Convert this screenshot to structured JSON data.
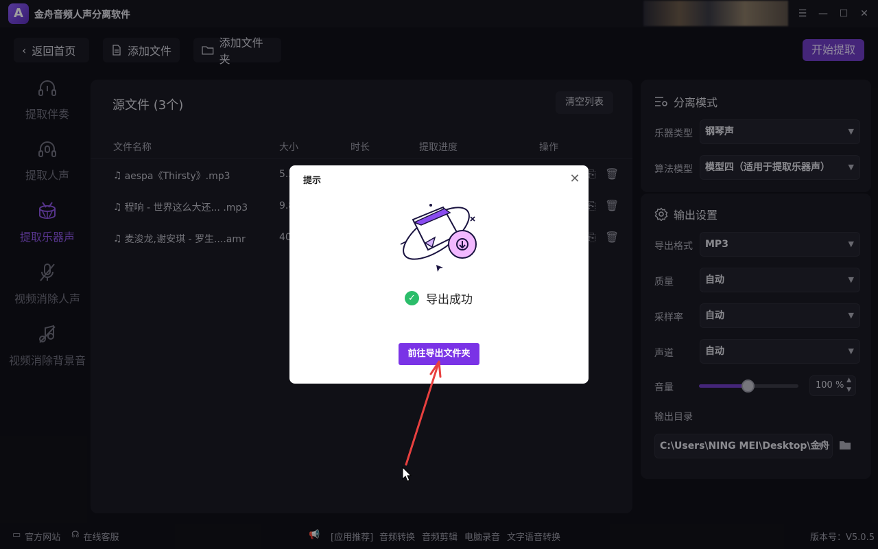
{
  "app": {
    "logo_text": "A",
    "title": "金舟音频人声分离软件"
  },
  "window_controls": {
    "menu": "☰",
    "minimize": "—",
    "maximize": "☐",
    "close": "✕"
  },
  "toolbar": {
    "back": "返回首页",
    "add_file": "添加文件",
    "add_folder": "添加文件夹",
    "start": "开始提取"
  },
  "sidebar": {
    "items": [
      {
        "label": "提取伴奏",
        "icon": "headphones-music-icon",
        "active": false
      },
      {
        "label": "提取人声",
        "icon": "headphones-mic-icon",
        "active": false
      },
      {
        "label": "提取乐器声",
        "icon": "drum-icon",
        "active": true
      },
      {
        "label": "视频消除人声",
        "icon": "mic-off-icon",
        "active": false
      },
      {
        "label": "视频消除背景音",
        "icon": "music-off-icon",
        "active": false
      }
    ]
  },
  "file_panel": {
    "title": "源文件 (3个)",
    "clear": "清空列表",
    "columns": [
      "文件名称",
      "大小",
      "时长",
      "提取进度",
      "操作"
    ],
    "rows": [
      {
        "name": "aespa《Thirsty》.mp3",
        "size": "5.5"
      },
      {
        "name": "程响 - 世界这么大还... .mp3",
        "size": "9.8"
      },
      {
        "name": "麦浚龙,谢安琪 - 罗生....amr",
        "size": "40"
      }
    ]
  },
  "separation": {
    "title": "分离模式",
    "instrument_label": "乐器类型",
    "instrument_value": "钢琴声",
    "algorithm_label": "算法模型",
    "algorithm_value": "模型四（适用于提取乐器声）"
  },
  "output": {
    "title": "输出设置",
    "format_label": "导出格式",
    "format_value": "MP3",
    "quality_label": "质量",
    "quality_value": "自动",
    "sample_label": "采样率",
    "sample_value": "自动",
    "channel_label": "声道",
    "channel_value": "自动",
    "volume_label": "音量",
    "volume_value": "100 %",
    "volume_level": 0.5,
    "dir_label": "输出目录",
    "dir_value": "C:\\Users\\NING MEI\\Desktop\\金舟"
  },
  "footer": {
    "website": "官方网站",
    "service": "在线客服",
    "recommend": "[应用推荐]",
    "links": [
      "音频转换",
      "音频剪辑",
      "电脑录音",
      "文字语音转换"
    ],
    "version": "版本号：V5.0.5"
  },
  "modal": {
    "title": "提示",
    "message": "导出成功",
    "button": "前往导出文件夹"
  },
  "colors": {
    "accent": "#7a33e6",
    "success": "#2bbd6a",
    "annotation_arrow": "#e8403f"
  }
}
